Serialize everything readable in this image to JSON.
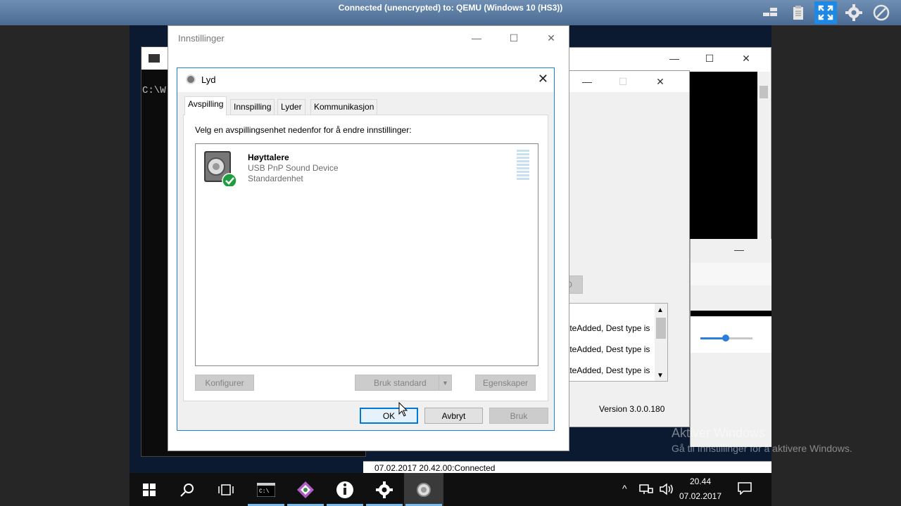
{
  "viewer": {
    "connection_title": "Connected (unencrypted) to: QEMU (Windows 10 (HS3))",
    "toolbar_icons": [
      "layout-icon",
      "clipboard-icon",
      "fullscreen-icon",
      "settings-icon",
      "disconnect-icon"
    ]
  },
  "cmd_window": {
    "prompt_text": "C:\\W"
  },
  "settings_window": {
    "title": "Innstillinger"
  },
  "app_window": {
    "button_pro": "PRO",
    "log_lines": [
      "n is DateAdded, Dest type is",
      "n is DateAdded, Dest type is",
      "n is DateAdded, Dest type is"
    ],
    "version": "Version 3.0.0.180",
    "status_line": "07.02.2017 20.42.00:Connected"
  },
  "sound_dialog": {
    "title": "Lyd",
    "tabs": [
      "Avspilling",
      "Innspilling",
      "Lyder",
      "Kommunikasjon"
    ],
    "instruction": "Velg en avspillingsenhet nedenfor for å endre innstillinger:",
    "device": {
      "name": "Høyttalere",
      "description": "USB PnP Sound Device",
      "status": "Standardenhet"
    },
    "buttons": {
      "configure": "Konfigurer",
      "set_default": "Bruk standard",
      "properties": "Egenskaper",
      "ok": "OK",
      "cancel": "Avbryt",
      "apply": "Bruk"
    }
  },
  "activation": {
    "line1": "Aktiver Windows",
    "line2": "Gå til Innstillinger for å aktivere Windows."
  },
  "taskbar": {
    "time": "20.44",
    "date": "07.02.2017"
  }
}
